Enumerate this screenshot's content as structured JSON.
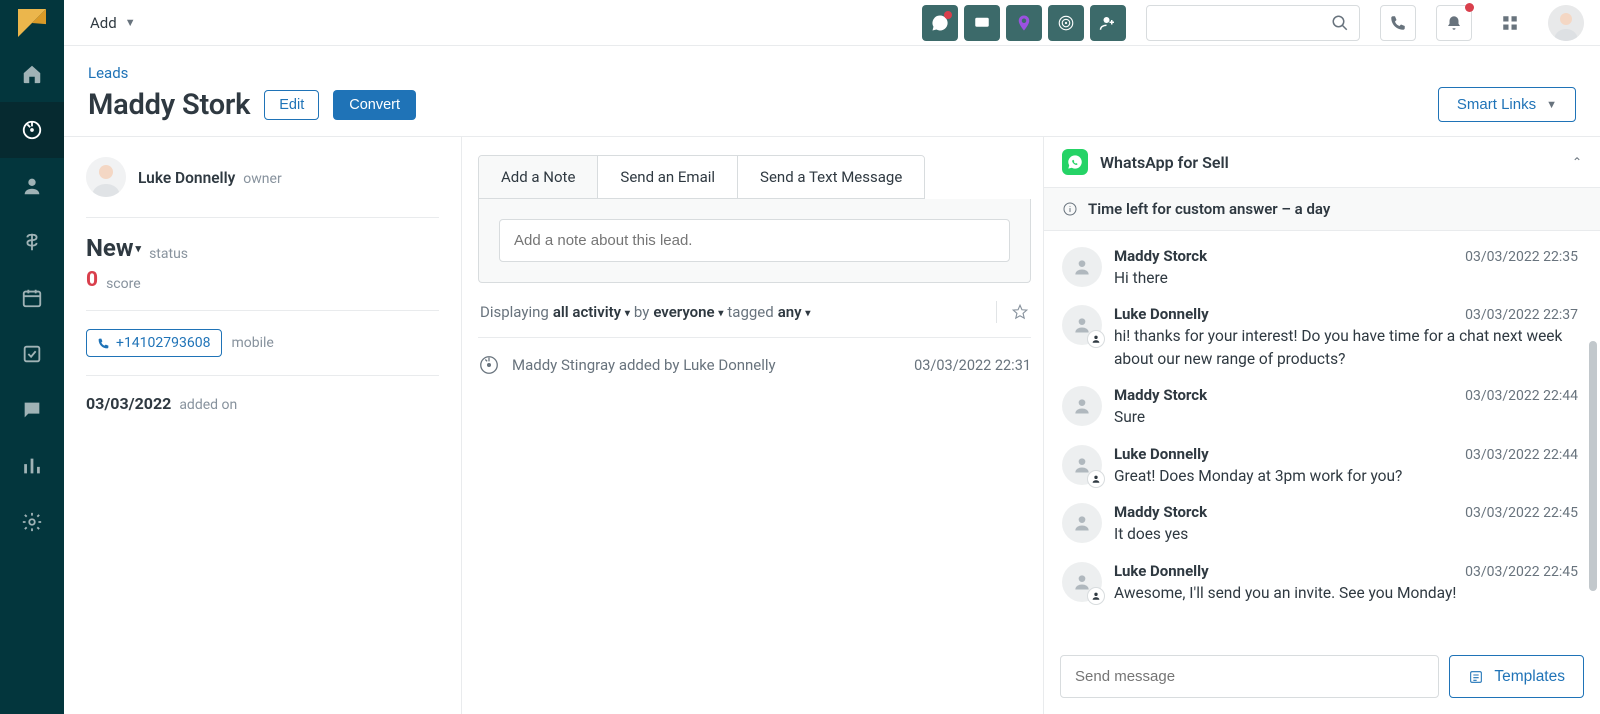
{
  "topbar": {
    "add_label": "Add"
  },
  "breadcrumb": "Leads",
  "lead": {
    "name": "Maddy Stork",
    "edit_label": "Edit",
    "convert_label": "Convert"
  },
  "smart_links_label": "Smart Links",
  "owner": {
    "name": "Luke Donnelly",
    "role": "owner"
  },
  "status": {
    "value": "New",
    "label": "status"
  },
  "score": {
    "value": "0",
    "label": "score"
  },
  "phone": {
    "number": "+14102793608",
    "label": "mobile"
  },
  "added": {
    "date": "03/03/2022",
    "label": "added on"
  },
  "tabs": {
    "note": "Add a Note",
    "email": "Send an Email",
    "sms": "Send a Text Message"
  },
  "note_placeholder": "Add a note about this lead.",
  "filter": {
    "prefix": "Displaying ",
    "activity": "all activity",
    "by": " by ",
    "who": "everyone",
    "tagged": " tagged ",
    "tag": "any"
  },
  "activity": {
    "text": "Maddy Stingray added by Luke Donnelly",
    "time": "03/03/2022 22:31"
  },
  "whatsapp": {
    "title": "WhatsApp for Sell",
    "alert": "Time left for custom answer – a day",
    "input_placeholder": "Send message",
    "templates_label": "Templates",
    "messages": [
      {
        "name": "Maddy Storck",
        "time": "03/03/2022 22:35",
        "text": "Hi there",
        "agent": false
      },
      {
        "name": "Luke Donnelly",
        "time": "03/03/2022 22:37",
        "text": "hi! thanks for your interest! Do you have time for a chat next week about our new range of products?",
        "agent": true
      },
      {
        "name": "Maddy Storck",
        "time": "03/03/2022 22:44",
        "text": "Sure",
        "agent": false
      },
      {
        "name": "Luke Donnelly",
        "time": "03/03/2022 22:44",
        "text": "Great! Does Monday at 3pm work for you?",
        "agent": true
      },
      {
        "name": "Maddy Storck",
        "time": "03/03/2022 22:45",
        "text": "It does yes",
        "agent": false
      },
      {
        "name": "Luke Donnelly",
        "time": "03/03/2022 22:45",
        "text": "Awesome, I'll send you an invite. See you Monday!",
        "agent": true
      }
    ]
  }
}
